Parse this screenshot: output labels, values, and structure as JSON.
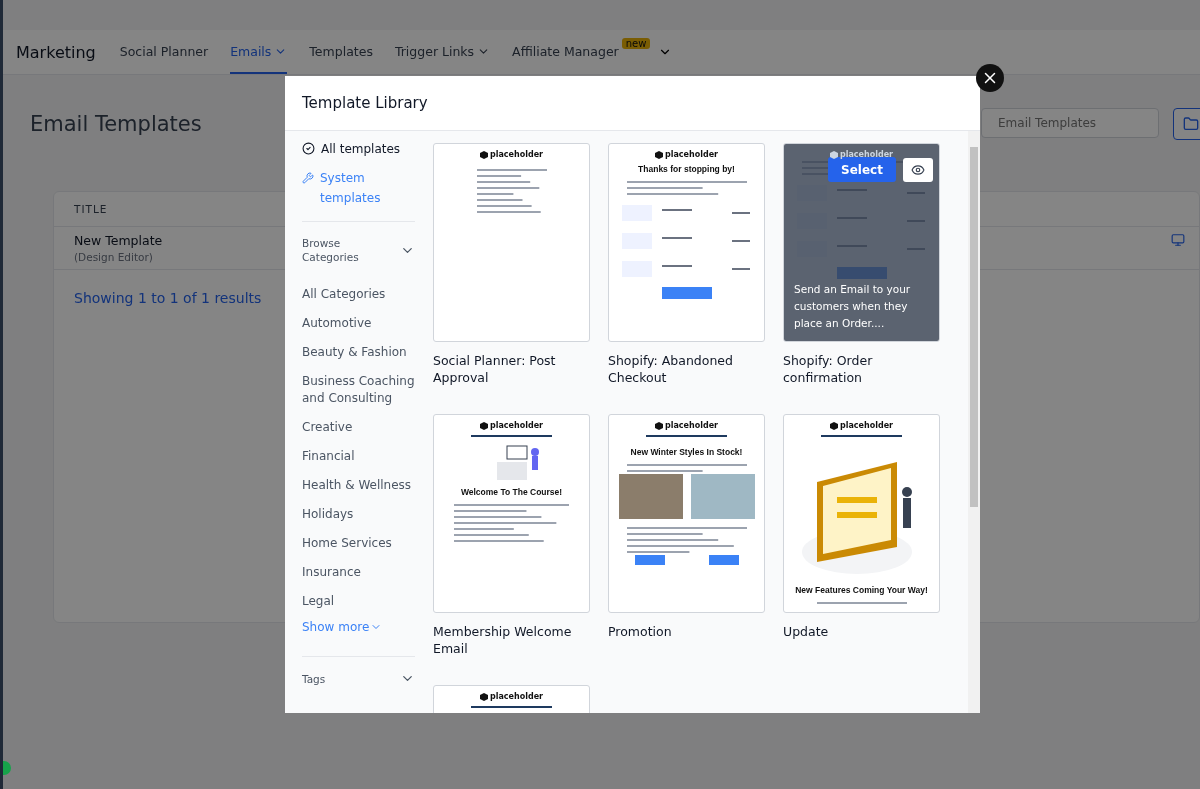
{
  "nav": {
    "brand": "Marketing",
    "tabs": [
      {
        "label": "Social Planner",
        "selected": false,
        "dropdown": false
      },
      {
        "label": "Emails",
        "selected": true,
        "dropdown": true
      },
      {
        "label": "Templates",
        "selected": false,
        "dropdown": false
      },
      {
        "label": "Trigger Links",
        "selected": false,
        "dropdown": true
      },
      {
        "label": "Affiliate Manager",
        "selected": false,
        "dropdown": false,
        "badge": "new"
      }
    ],
    "more_dropdown": true
  },
  "page": {
    "title": "Email Templates",
    "search": {
      "placeholder": "Email Templates"
    },
    "table": {
      "columns": [
        "TITLE"
      ],
      "rows": [
        {
          "title": "New Template",
          "subtitle": "(Design Editor)"
        }
      ],
      "footer": "Showing 1 to 1 of 1 results"
    }
  },
  "modal": {
    "title": "Template Library",
    "filters": [
      {
        "label": "All templates",
        "kind": "check",
        "selected": false
      },
      {
        "label": "System templates",
        "kind": "wrench",
        "selected": true
      }
    ],
    "browse": {
      "label": "Browse Categories",
      "expanded": true
    },
    "categories": [
      "All Categories",
      "Automotive",
      "Beauty & Fashion",
      "Business Coaching and Consulting",
      "Creative",
      "Financial",
      "Health & Wellness",
      "Holidays",
      "Home Services",
      "Insurance",
      "Legal"
    ],
    "show_more": "Show more",
    "tags": {
      "label": "Tags",
      "expanded": false
    },
    "templates": [
      {
        "name": "Social Planner: Post Approval",
        "kind": "plain",
        "logo": "placeholder",
        "hovered": false
      },
      {
        "name": "Shopify: Abandoned Checkout",
        "kind": "cart",
        "logo": "placeholder",
        "heading": "Thanks for stopping by!",
        "hovered": false
      },
      {
        "name": "Shopify: Order confirmation",
        "kind": "cart",
        "logo": "placeholder",
        "hovered": true,
        "description": "Send an Email to your customers when they place an Order....",
        "select": "Select"
      },
      {
        "name": "Membership Welcome Email",
        "kind": "course",
        "logo": "placeholder",
        "heading": "Welcome To The Course!",
        "hovered": false
      },
      {
        "name": "Promotion",
        "kind": "promo",
        "logo": "placeholder",
        "heading": "New Winter Styles In Stock!",
        "hovered": false
      },
      {
        "name": "Update",
        "kind": "update",
        "logo": "placeholder",
        "heading": "New Features Coming Your Way!",
        "hovered": false
      },
      {
        "kind": "partial",
        "logo": "placeholder",
        "hovered": false
      }
    ]
  }
}
